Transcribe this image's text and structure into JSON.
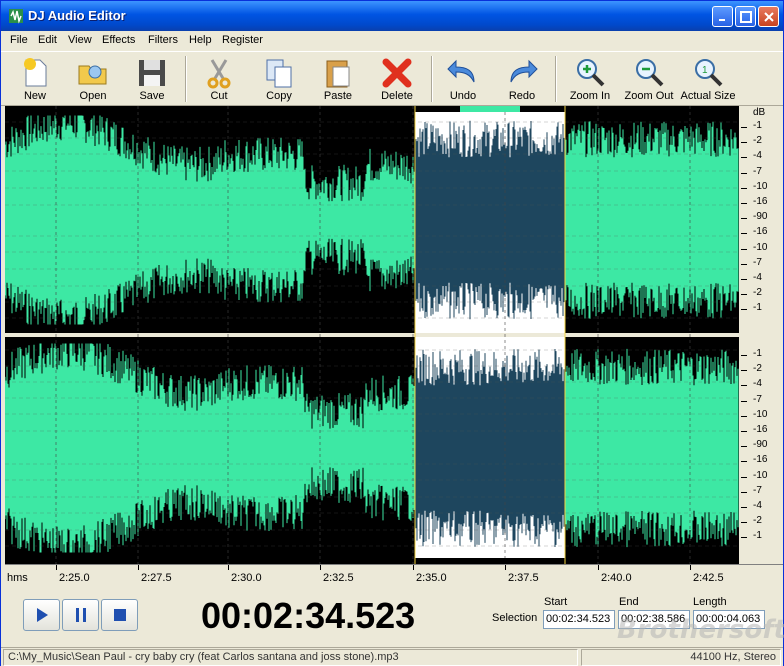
{
  "app": {
    "title": "DJ Audio Editor"
  },
  "menu": [
    "File",
    "Edit",
    "View",
    "Effects",
    "Filters",
    "Help",
    "Register"
  ],
  "toolbar": {
    "new": "New",
    "open": "Open",
    "save": "Save",
    "cut": "Cut",
    "copy": "Copy",
    "paste": "Paste",
    "delete": "Delete",
    "undo": "Undo",
    "redo": "Redo",
    "zoom_in": "Zoom In",
    "zoom_out": "Zoom Out",
    "actual_size": "Actual Size"
  },
  "db_scale": {
    "unit": "dB",
    "top_channel": [
      "-1",
      "-2",
      "-4",
      "-7",
      "-10",
      "-16",
      "-90",
      "-16",
      "-10",
      "-7",
      "-4",
      "-2",
      "-1"
    ],
    "bottom_channel": [
      "-1",
      "-2",
      "-4",
      "-7",
      "-10",
      "-16",
      "-90",
      "-16",
      "-10",
      "-7",
      "-4",
      "-2",
      "-1"
    ]
  },
  "ruler": {
    "unit": "hms",
    "ticks": [
      "2:25.0",
      "2:27.5",
      "2:30.0",
      "2:32.5",
      "2:35.0",
      "2:37.5",
      "2:40.0",
      "2:42.5"
    ]
  },
  "transport": {
    "timecode": "00:02:34.523"
  },
  "selection": {
    "label": "Selection",
    "start_label": "Start",
    "end_label": "End",
    "length_label": "Length",
    "start": "00:02:34.523",
    "end": "00:02:38.586",
    "length": "00:00:04.063"
  },
  "status": {
    "file": "C:\\My_Music\\Sean Paul - cry baby cry (feat Carlos santana and joss stone).mp3",
    "format": "44100 Hz, Stereo"
  },
  "watermark": "Brothersoft",
  "colors": {
    "waveform": "#3DE8A4",
    "selection_bg": "#1E465E",
    "selection_plot": "#FFFFFF",
    "background": "#000000"
  }
}
